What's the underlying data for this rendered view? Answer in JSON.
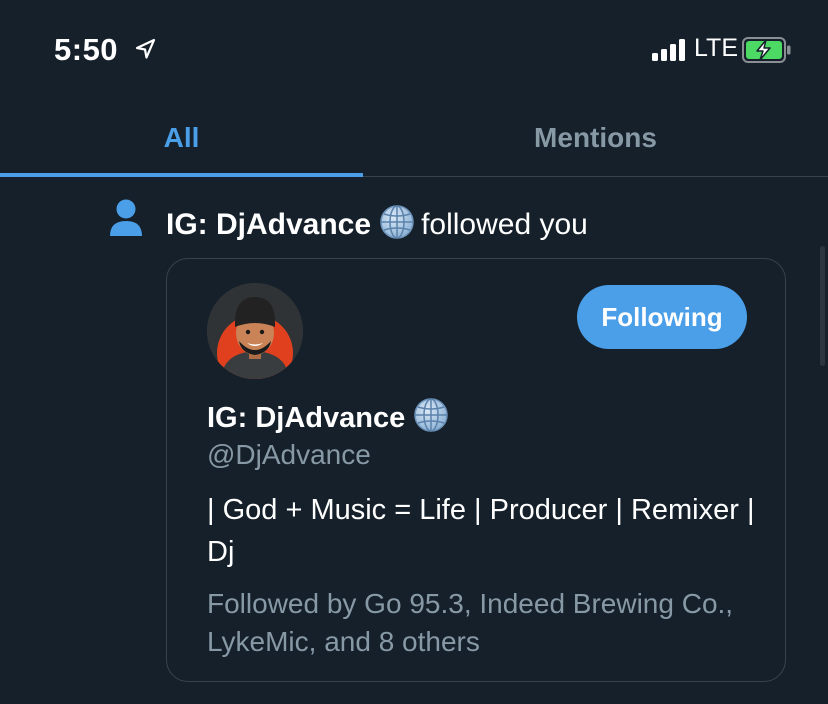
{
  "status_bar": {
    "time": "5:50",
    "network": "LTE",
    "icons": [
      "location-arrow-icon",
      "signal-icon",
      "battery-charging-icon"
    ]
  },
  "tabs": [
    {
      "label": "All",
      "active": true
    },
    {
      "label": "Mentions",
      "active": false
    }
  ],
  "notification": {
    "icon": "person-icon",
    "actor_name": "IG: DjAdvance",
    "actor_emoji": "globe-icon",
    "action": "followed you",
    "card": {
      "name": "IG: DjAdvance",
      "handle": "@DjAdvance",
      "bio": "| God + Music = Life | Producer | Remixer | Dj",
      "followed_by": "Followed by Go 95.3, Indeed Brewing Co., LykeMic, and 8 others",
      "button_label": "Following"
    }
  },
  "colors": {
    "background": "#15202b",
    "accent": "#4a9fe8",
    "secondary_text": "#8899a6",
    "border": "#38444d",
    "battery": "#4cd964"
  }
}
